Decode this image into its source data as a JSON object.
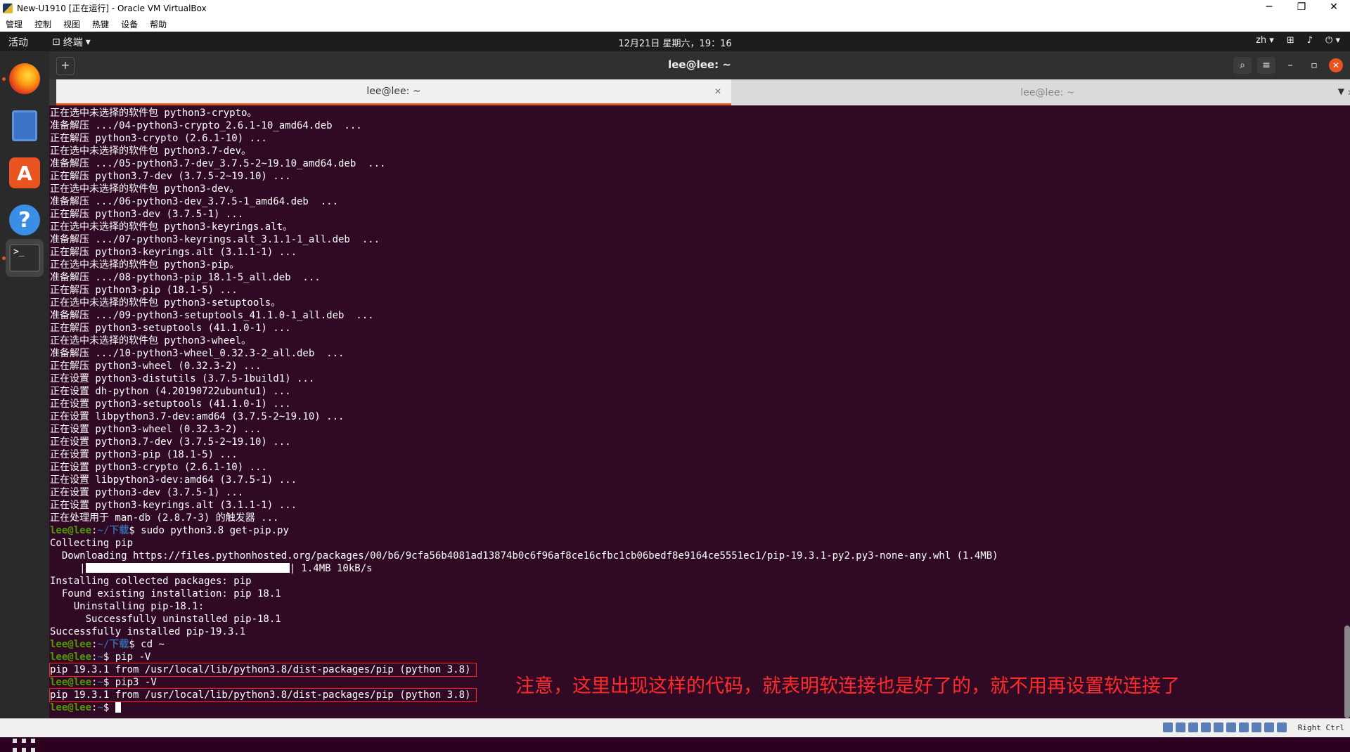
{
  "vbox": {
    "title": "New-U1910 [正在运行] - Oracle VM VirtualBox",
    "menu": [
      "管理",
      "控制",
      "视图",
      "热键",
      "设备",
      "帮助"
    ],
    "controls": {
      "minimize": "─",
      "restore": "❐",
      "close": "✕"
    }
  },
  "topbar": {
    "activities": "活动",
    "app_menu": "终端",
    "clock": "12月21日 星期六，19：16",
    "lang": "zh"
  },
  "terminal_window": {
    "title": "lee@lee: ~",
    "tabs": [
      "lee@lee: ~",
      "lee@lee: ~"
    ]
  },
  "terminal": {
    "lines": [
      "正在选中未选择的软件包 python3-crypto。",
      "准备解压 .../04-python3-crypto_2.6.1-10_amd64.deb  ...",
      "正在解压 python3-crypto (2.6.1-10) ...",
      "正在选中未选择的软件包 python3.7-dev。",
      "准备解压 .../05-python3.7-dev_3.7.5-2~19.10_amd64.deb  ...",
      "正在解压 python3.7-dev (3.7.5-2~19.10) ...",
      "正在选中未选择的软件包 python3-dev。",
      "准备解压 .../06-python3-dev_3.7.5-1_amd64.deb  ...",
      "正在解压 python3-dev (3.7.5-1) ...",
      "正在选中未选择的软件包 python3-keyrings.alt。",
      "准备解压 .../07-python3-keyrings.alt_3.1.1-1_all.deb  ...",
      "正在解压 python3-keyrings.alt (3.1.1-1) ...",
      "正在选中未选择的软件包 python3-pip。",
      "准备解压 .../08-python3-pip_18.1-5_all.deb  ...",
      "正在解压 python3-pip (18.1-5) ...",
      "正在选中未选择的软件包 python3-setuptools。",
      "准备解压 .../09-python3-setuptools_41.1.0-1_all.deb  ...",
      "正在解压 python3-setuptools (41.1.0-1) ...",
      "正在选中未选择的软件包 python3-wheel。",
      "准备解压 .../10-python3-wheel_0.32.3-2_all.deb  ...",
      "正在解压 python3-wheel (0.32.3-2) ...",
      "正在设置 python3-distutils (3.7.5-1build1) ...",
      "正在设置 dh-python (4.20190722ubuntu1) ...",
      "正在设置 python3-setuptools (41.1.0-1) ...",
      "正在设置 libpython3.7-dev:amd64 (3.7.5-2~19.10) ...",
      "正在设置 python3-wheel (0.32.3-2) ...",
      "正在设置 python3.7-dev (3.7.5-2~19.10) ...",
      "正在设置 python3-pip (18.1-5) ...",
      "正在设置 python3-crypto (2.6.1-10) ...",
      "正在设置 libpython3-dev:amd64 (3.7.5-1) ...",
      "正在设置 python3-dev (3.7.5-1) ...",
      "正在设置 python3-keyrings.alt (3.1.1-1) ...",
      "正在处理用于 man-db (2.8.7-3) 的触发器 ..."
    ],
    "prompt_user": "lee@lee",
    "path_download": "~/下载",
    "path_home": "~",
    "cmd_getpip": "sudo python3.8 get-pip.py",
    "collecting": "Collecting pip",
    "downloading": "  Downloading https://files.pythonhosted.org/packages/00/b6/9cfa56b4081ad13874b0c6f96af8ce16cfbc1cb06bedf8e9164ce5551ec1/pip-19.3.1-py2.py3-none-any.whl (1.4MB)",
    "progress_prefix": "     |",
    "progress_suffix": "| 1.4MB 10kB/s",
    "progress_fraction": 1.0,
    "installing": "Installing collected packages: pip",
    "found": "  Found existing installation: pip 18.1",
    "uninstalling": "    Uninstalling pip-18.1:",
    "uninstalled": "      Successfully uninstalled pip-18.1",
    "installed": "Successfully installed pip-19.3.1",
    "cmd_cd": "cd ~",
    "cmd_pip": "pip -V",
    "pip_out": "pip 19.3.1 from /usr/local/lib/python3.8/dist-packages/pip (python 3.8)",
    "cmd_pip3": "pip3 -V",
    "pip3_out": "pip 19.3.1 from /usr/local/lib/python3.8/dist-packages/pip (python 3.8)"
  },
  "annotation": "注意，这里出现这样的代码，就表明软连接也是好了的，就不用再设置软连接了",
  "statusbar": {
    "host_key": "Right Ctrl"
  },
  "colors": {
    "terminal_bg": "#300a24",
    "prompt_user": "#4e9a06",
    "prompt_path": "#3465a4",
    "annotation": "#ff2b2b",
    "accent": "#e95420"
  }
}
